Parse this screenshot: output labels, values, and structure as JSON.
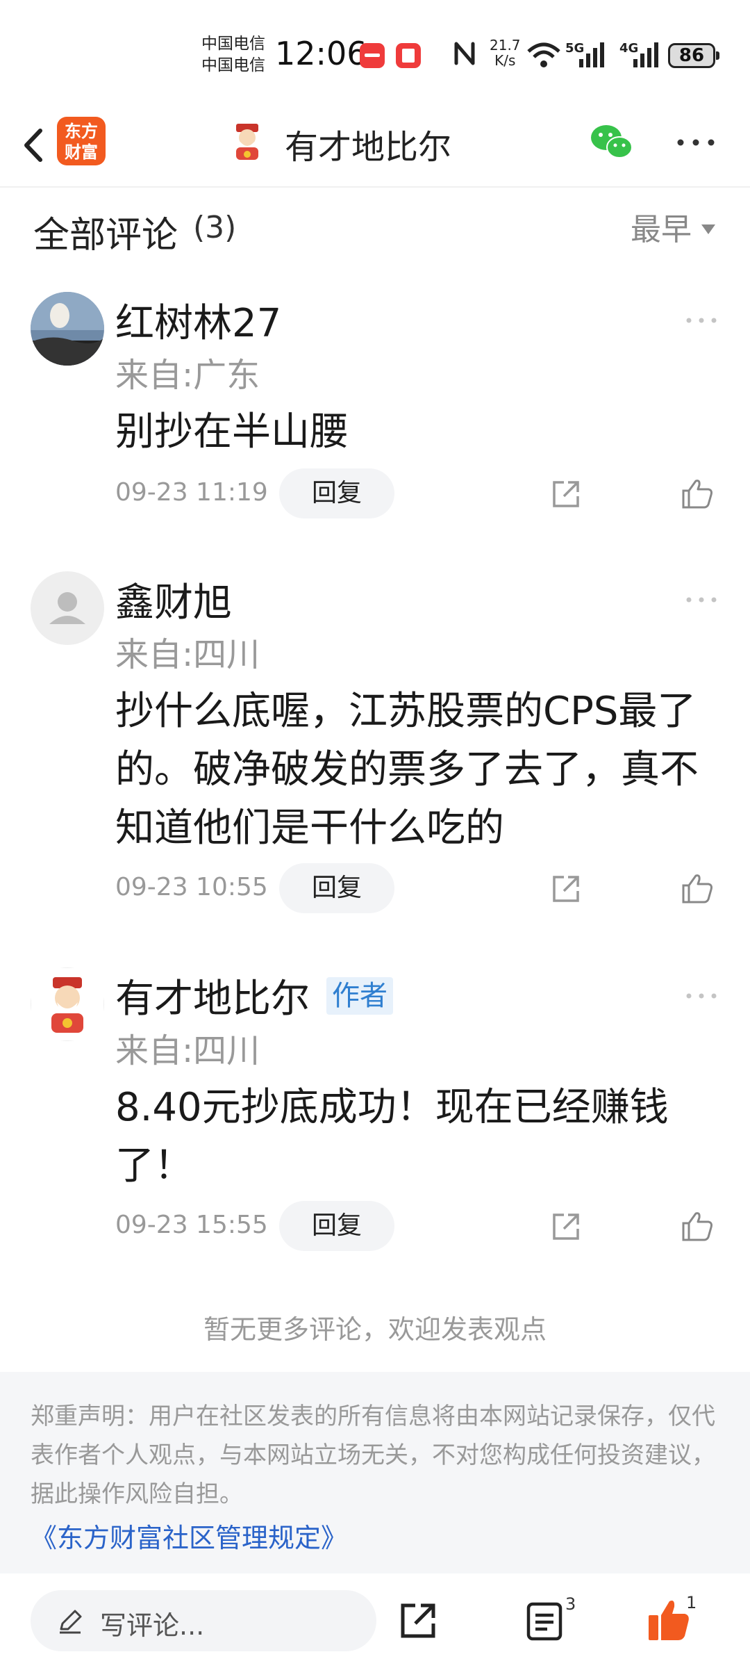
{
  "status_bar": {
    "carrier_1": "中国电信",
    "carrier_2": "中国电信",
    "time": "12:06",
    "net_speed_value": "21.7",
    "net_speed_unit": "K/s",
    "signal_1": "5G",
    "signal_2": "4G",
    "battery": "86"
  },
  "nav": {
    "brand_line1": "东方",
    "brand_line2": "财富",
    "title": "有才地比尔"
  },
  "comments_header": {
    "title": "全部评论",
    "count": "(3)",
    "sort": "最早"
  },
  "comments": [
    {
      "name": "红树林27",
      "location": "来自:广东",
      "text": "别抄在半山腰",
      "time": "09-23 11:19",
      "reply": "回复"
    },
    {
      "name": "鑫财旭",
      "location": "来自:四川",
      "text": "抄什么底喔，江苏股票的CPS最了的。破净破发的票多了去了，真不知道他们是干什么吃的",
      "time": "09-23 10:55",
      "reply": "回复"
    },
    {
      "name": "有才地比尔",
      "badge": "作者",
      "location": "来自:四川",
      "text": "8.40元抄底成功！现在已经赚钱了！",
      "time": "09-23 15:55",
      "reply": "回复"
    }
  ],
  "no_more": "暂无更多评论，欢迎发表观点",
  "disclaimer": {
    "text": "郑重声明：用户在社区发表的所有信息将由本网站记录保存，仅代表作者个人观点，与本网站立场无关，不对您构成任何投资建议，据此操作风险自担。",
    "link": "《东方财富社区管理规定》"
  },
  "bottom_bar": {
    "input_placeholder": "写评论...",
    "comment_count": "3",
    "like_count": "1"
  },
  "colors": {
    "brand": "#f25a1f",
    "link": "#2a63c9",
    "author_badge_bg": "#e7f1fb",
    "author_badge_text": "#2f7fd0",
    "like_active": "#f25a1f"
  }
}
